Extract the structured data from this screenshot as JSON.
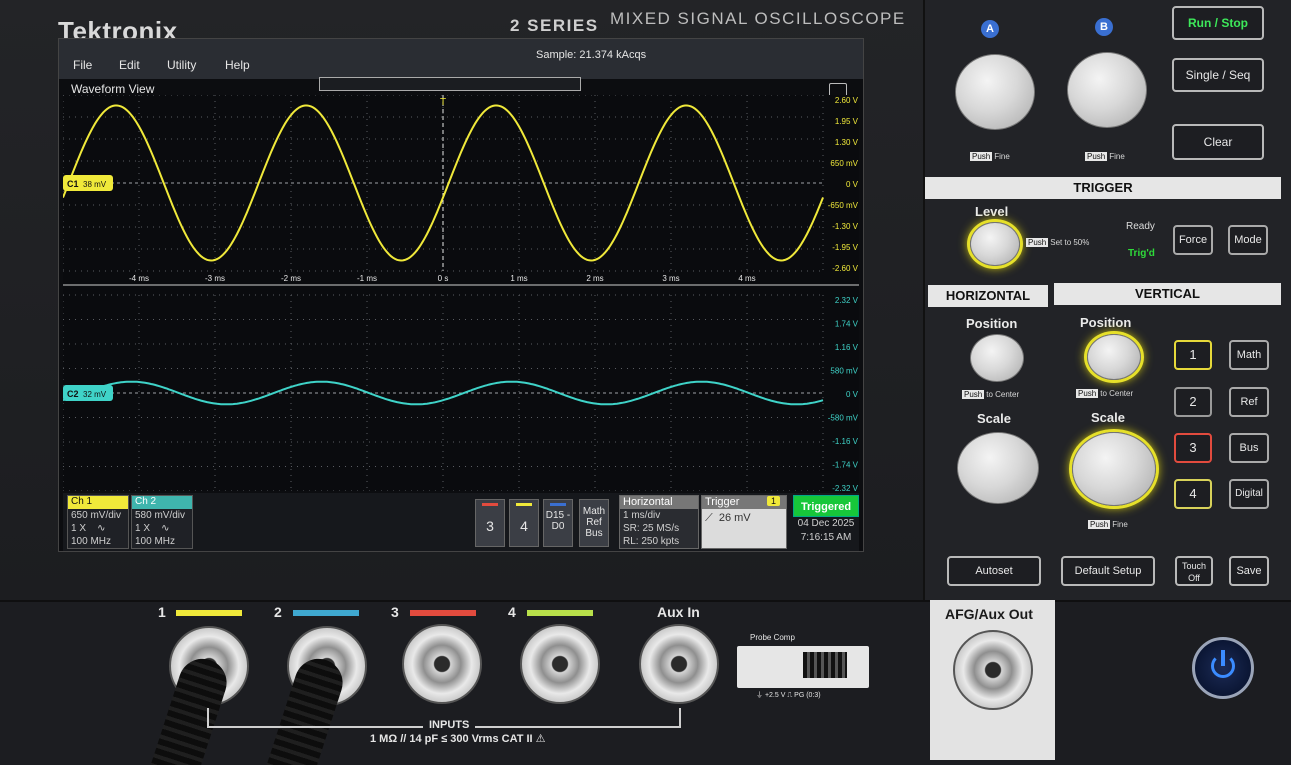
{
  "device": {
    "brand": "Tektronix",
    "series": "2 SERIES",
    "model": "MIXED SIGNAL OSCILLOSCOPE"
  },
  "screen": {
    "menu": [
      "File",
      "Edit",
      "Utility",
      "Help"
    ],
    "sample_status": "Sample: 21.374 kAcqs",
    "view_title": "Waveform View",
    "trigger_marker": "T",
    "cursor_marker": "C"
  },
  "colors": {
    "ch1": "#f0e93a",
    "ch2": "#3fd3c8",
    "ch3": "#e24b3e",
    "ch4": "#b8e04a",
    "triggered": "#17c73a",
    "ab_blue": "#3a6fd1",
    "power_blue": "#3b8cff"
  },
  "chart_data": [
    {
      "type": "line",
      "title": "",
      "x_tick_labels": [
        "-4 ms",
        "-3 ms",
        "-2 ms",
        "-1 ms",
        "0 s",
        "1 ms",
        "2 ms",
        "3 ms",
        "4 ms"
      ],
      "y_tick_labels": [
        "2.60 V",
        "1.95 V",
        "1.30 V",
        "650 mV",
        "0 V",
        "-650 mV",
        "-1.30 V",
        "-1.95 V",
        "-2.60 V"
      ],
      "x_range_ms": [
        -5,
        5
      ],
      "ylim": [
        -2.6,
        2.6
      ],
      "grid": true,
      "series": [
        {
          "name": "C1",
          "amplitude": 2.4,
          "period_ms": 2.5,
          "phase_peak_ms": -4.3,
          "label": "C1",
          "offset_label": "38 mV"
        }
      ]
    },
    {
      "type": "line",
      "title": "",
      "y_tick_labels": [
        "2.32 V",
        "1.74 V",
        "1.16 V",
        "580 mV",
        "0 V",
        "-580 mV",
        "-1.16 V",
        "-1.74 V",
        "-2.32 V"
      ],
      "x_range_ms": [
        -5,
        5
      ],
      "ylim": [
        -2.32,
        2.32
      ],
      "grid": true,
      "series": [
        {
          "name": "C2",
          "amplitude": 0.28,
          "period_ms": 2.5,
          "phase_peak_ms": -1.6,
          "label": "C2",
          "offset_label": "32 mV"
        }
      ]
    }
  ],
  "badges": {
    "ch1": {
      "title": "Ch 1",
      "scale": "650 mV/div",
      "probe": "1 X",
      "coupling": "∿",
      "bw": "100 MHz"
    },
    "ch2": {
      "title": "Ch 2",
      "scale": "580 mV/div",
      "probe": "1 X",
      "coupling": "∿",
      "bw": "100 MHz"
    },
    "chip3": "3",
    "chip4": "4",
    "digital": "D15 -D0",
    "math": "Math Ref Bus",
    "horizontal": {
      "title": "Horizontal",
      "scale": "1 ms/div",
      "sr": "SR: 25 MS/s",
      "rl": "RL: 250 kpts"
    },
    "trigger": {
      "title": "Trigger",
      "source": "1",
      "level": "26 mV"
    },
    "status": "Triggered",
    "date": "04 Dec 2025",
    "time": "7:16:15 AM"
  },
  "panel": {
    "a_label": "A",
    "b_label": "B",
    "run_stop": "Run / Stop",
    "single_seq": "Single / Seq",
    "clear": "Clear",
    "push": "Push",
    "fine": "Fine",
    "trigger_head": "TRIGGER",
    "level": "Level",
    "set_50": "Set to 50%",
    "ready": "Ready",
    "trigd": "Trig'd",
    "force": "Force",
    "mode": "Mode",
    "horizontal_head": "HORIZONTAL",
    "vertical_head": "VERTICAL",
    "position": "Position",
    "to_center": "to Center",
    "scale": "Scale",
    "ch_buttons": [
      "1",
      "2",
      "3",
      "4"
    ],
    "side_buttons": [
      "Math",
      "Ref",
      "Bus",
      "Digital"
    ],
    "autoset": "Autoset",
    "default_setup": "Default Setup",
    "touch_off": "Touch Off",
    "save": "Save"
  },
  "front": {
    "ch_labels": [
      "1",
      "2",
      "3",
      "4"
    ],
    "aux_in": "Aux In",
    "inputs": "INPUTS",
    "input_spec": "1 MΩ // 14 pF ≤ 300 Vrms CAT II ⚠",
    "probe_comp": "Probe Comp",
    "probe_foot": "⏚   +2.5 V ⎍     PG (0:3)",
    "afg": "AFG/Aux Out"
  }
}
